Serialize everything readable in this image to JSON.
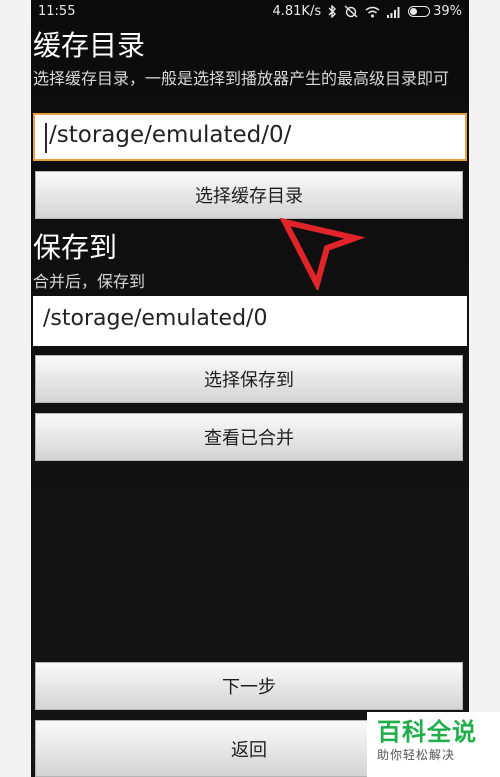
{
  "status_bar": {
    "time": "11:55",
    "network_speed": "4.81K/s",
    "battery_percent": "39%",
    "battery_level": 0.39
  },
  "cache_section": {
    "title": "缓存目录",
    "description": "选择缓存目录，一般是选择到播放器产生的最高级目录即可",
    "path_value": "/storage/emulated/0/",
    "choose_button": "选择缓存目录"
  },
  "save_section": {
    "title": "保存到",
    "description": "合并后，保存到",
    "path_value": "/storage/emulated/0",
    "choose_button": "选择保存到",
    "view_merged_button": "查看已合并"
  },
  "footer": {
    "next_button": "下一步",
    "back_button": "返回"
  },
  "watermark": {
    "title": "百科全说",
    "subtitle": "助你轻松解决"
  },
  "colors": {
    "focus_border": "#e7a23f",
    "annotation_arrow": "#e0242a",
    "watermark_green": "#1fae4a"
  }
}
